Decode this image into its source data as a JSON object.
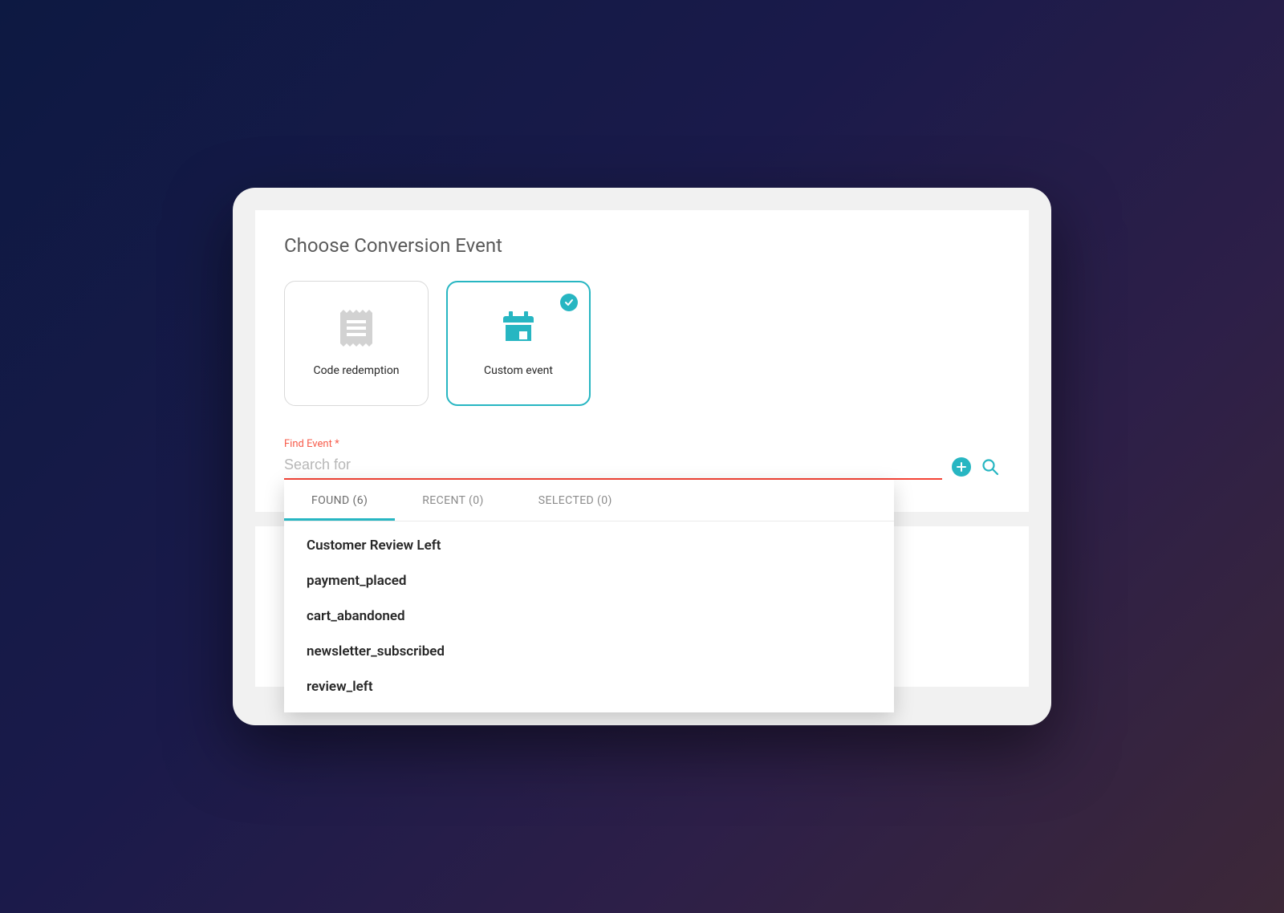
{
  "title": "Choose Conversion Event",
  "cards": {
    "code_redemption": {
      "label": "Code redemption"
    },
    "custom_event": {
      "label": "Custom event"
    }
  },
  "field": {
    "label": "Find Event *",
    "placeholder": "Search for"
  },
  "tabs": {
    "found": {
      "label": "FOUND (6)"
    },
    "recent": {
      "label": "RECENT (0)"
    },
    "selected": {
      "label": "SELECTED (0)"
    }
  },
  "results": [
    "Customer Review Left",
    "payment_placed",
    "cart_abandoned",
    "newsletter_subscribed",
    "review_left"
  ],
  "colors": {
    "accent": "#27b6c2",
    "error": "#f44336"
  }
}
